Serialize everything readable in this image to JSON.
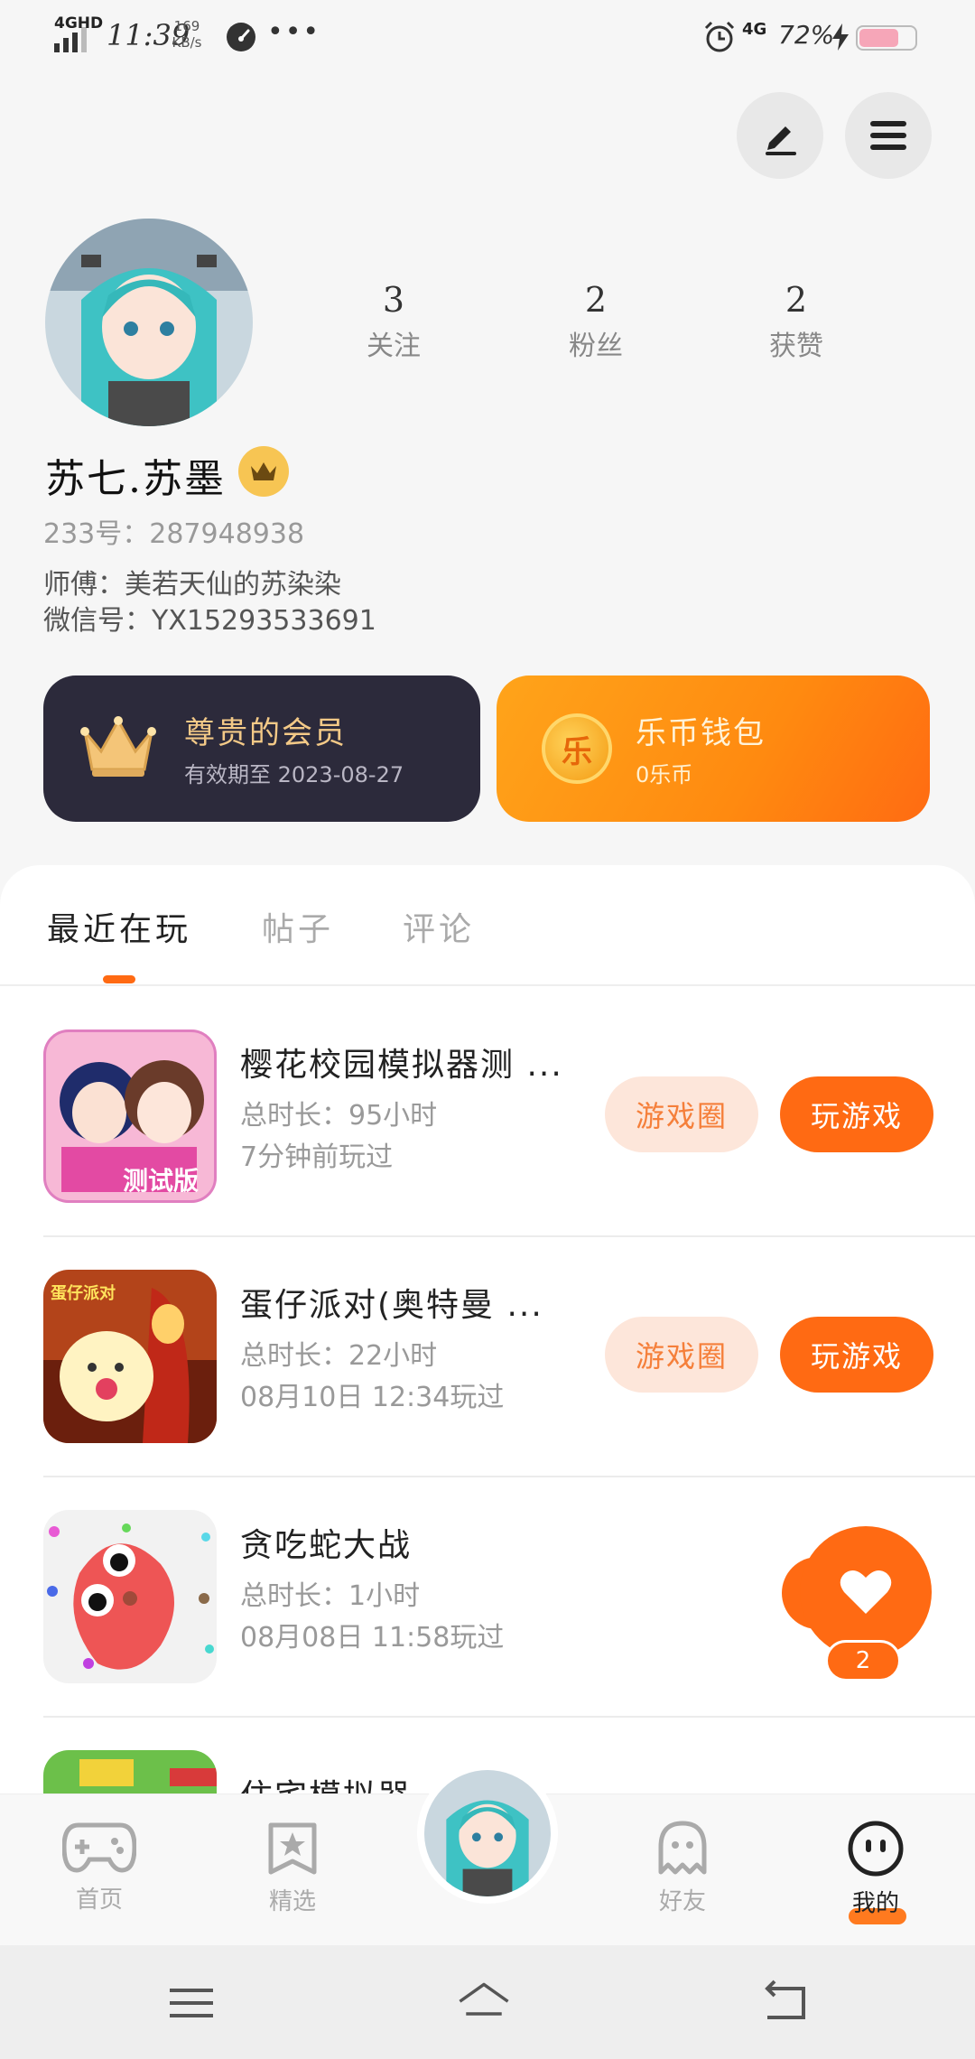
{
  "status_bar": {
    "network": "4GHD",
    "time": "11:39",
    "speed_value": "169",
    "speed_unit": "KB/s",
    "dots": "•••",
    "network2": "4G",
    "battery": "72%",
    "battery_level": 0.72
  },
  "header": {
    "edit_icon": "edit-icon",
    "menu_icon": "menu-icon"
  },
  "profile": {
    "stats": [
      {
        "value": "3",
        "label": "关注"
      },
      {
        "value": "2",
        "label": "粉丝"
      },
      {
        "value": "2",
        "label": "获赞"
      }
    ],
    "username": "苏七.苏墨",
    "account_id": "233号：287948938",
    "mentor": "师傅：美若天仙的苏染染",
    "wechat": "微信号：YX15293533691"
  },
  "cards": {
    "vip": {
      "title": "尊贵的会员",
      "expiry": "有效期至 2023-08-27"
    },
    "wallet": {
      "coin_char": "乐",
      "title": "乐币钱包",
      "sub": "0乐币"
    }
  },
  "tabs": {
    "recent": "最近在玩",
    "posts": "帖子",
    "comments": "评论"
  },
  "games": [
    {
      "title": "樱花校园模拟器测 ...",
      "duration": "总时长：95小时",
      "last": "7分钟前玩过",
      "circle_label": "游戏圈",
      "play_label": "玩游戏",
      "icon_text": "测试版"
    },
    {
      "title": "蛋仔派对(奥特曼 ...",
      "duration": "总时长：22小时",
      "last": "08月10日 12:34玩过",
      "circle_label": "游戏圈",
      "play_label": "玩游戏",
      "icon_text": "蛋仔派对"
    },
    {
      "title": "贪吃蛇大战",
      "duration": "总时长：1小时",
      "last": "08月08日 11:58玩过"
    },
    {
      "title": "住宅模拟器"
    }
  ],
  "fab": {
    "count": "2"
  },
  "bottom_nav": [
    {
      "label": "首页"
    },
    {
      "label": "精选"
    },
    {
      "label": "好友"
    },
    {
      "label": "我的"
    }
  ],
  "colors": {
    "accent": "#ff6a13",
    "vip_bg": "#2c2a3b",
    "vip_gold": "#f3c987",
    "wallet_orange": "#ffa41a"
  }
}
